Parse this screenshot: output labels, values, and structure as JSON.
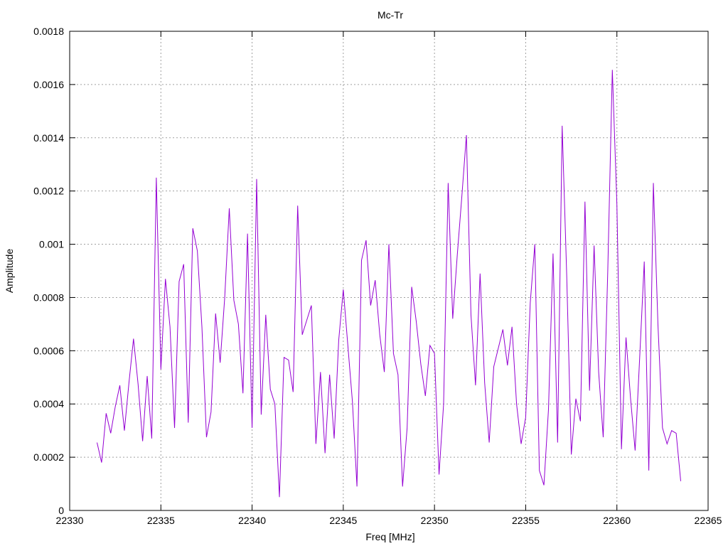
{
  "chart_data": {
    "type": "line",
    "title": "Mc-Tr",
    "xlabel": "Freq [MHz]",
    "ylabel": "Amplitude",
    "xlim": [
      22330,
      22365
    ],
    "ylim": [
      0,
      0.0018
    ],
    "xticks": [
      22330,
      22335,
      22340,
      22345,
      22350,
      22355,
      22360,
      22365
    ],
    "xtick_labels": [
      "22330",
      "22335",
      "22340",
      "22345",
      "22350",
      "22355",
      "22360",
      "22365"
    ],
    "yticks": [
      0,
      0.0002,
      0.0004,
      0.0006,
      0.0008,
      0.001,
      0.0012,
      0.0014,
      0.0016,
      0.0018
    ],
    "ytick_labels": [
      "0",
      "0.0002",
      "0.0004",
      "0.0006",
      "0.0008",
      "0.001",
      "0.0012",
      "0.0014",
      "0.0016",
      "0.0018"
    ],
    "grid": true,
    "legend": "none",
    "colors": {
      "line": "#9400d3",
      "grid": "#a0a0a0",
      "axis": "#000000"
    },
    "series": [
      {
        "x": [
          22331.5,
          22331.75,
          22332.0,
          22332.25,
          22332.5,
          22332.75,
          22333.0,
          22333.25,
          22333.5,
          22333.75,
          22334.0,
          22334.25,
          22334.5,
          22334.75,
          22335.0,
          22335.25,
          22335.5,
          22335.75,
          22336.0,
          22336.25,
          22336.5,
          22336.75,
          22337.0,
          22337.25,
          22337.5,
          22337.75,
          22338.0,
          22338.25,
          22338.5,
          22338.75,
          22339.0,
          22339.25,
          22339.5,
          22339.75,
          22340.0,
          22340.25,
          22340.5,
          22340.75,
          22341.0,
          22341.25,
          22341.5,
          22341.75,
          22342.0,
          22342.25,
          22342.5,
          22342.75,
          22343.0,
          22343.25,
          22343.5,
          22343.75,
          22344.0,
          22344.25,
          22344.5,
          22344.75,
          22345.0,
          22345.25,
          22345.5,
          22345.75,
          22346.0,
          22346.25,
          22346.5,
          22346.75,
          22347.0,
          22347.25,
          22347.5,
          22347.75,
          22348.0,
          22348.25,
          22348.5,
          22348.75,
          22349.0,
          22349.25,
          22349.5,
          22349.75,
          22350.0,
          22350.25,
          22350.5,
          22350.75,
          22351.0,
          22351.25,
          22351.5,
          22351.75,
          22352.0,
          22352.25,
          22352.5,
          22352.75,
          22353.0,
          22353.25,
          22353.5,
          22353.75,
          22354.0,
          22354.25,
          22354.5,
          22354.75,
          22355.0,
          22355.25,
          22355.5,
          22355.75,
          22356.0,
          22356.25,
          22356.5,
          22356.75,
          22357.0,
          22357.25,
          22357.5,
          22357.75,
          22358.0,
          22358.25,
          22358.5,
          22358.75,
          22359.0,
          22359.25,
          22359.5,
          22359.75,
          22360.0,
          22360.25,
          22360.5,
          22360.75,
          22361.0,
          22361.25,
          22361.5,
          22361.75,
          22362.0,
          22362.25,
          22362.5,
          22362.75,
          22363.0,
          22363.25,
          22363.5
        ],
        "y": [
          0.000255,
          0.00018,
          0.000365,
          0.00029,
          0.00039,
          0.00047,
          0.0003,
          0.00048,
          0.000645,
          0.000475,
          0.00026,
          0.000505,
          0.00027,
          0.00125,
          0.00053,
          0.00087,
          0.00069,
          0.00031,
          0.00086,
          0.000925,
          0.00033,
          0.00106,
          0.000975,
          0.00069,
          0.000275,
          0.00037,
          0.00074,
          0.000555,
          0.0008,
          0.001135,
          0.00079,
          0.0007,
          0.00044,
          0.00104,
          0.00031,
          0.001245,
          0.00036,
          0.000735,
          0.000455,
          0.0004,
          5e-05,
          0.000575,
          0.000565,
          0.000445,
          0.001145,
          0.00066,
          0.000715,
          0.00077,
          0.00025,
          0.00052,
          0.000215,
          0.00051,
          0.00027,
          0.00064,
          0.00083,
          0.00062,
          0.00041,
          9e-05,
          0.00094,
          0.001015,
          0.00077,
          0.000865,
          0.00066,
          0.00052,
          0.001,
          0.00059,
          0.00051,
          9e-05,
          0.00031,
          0.00084,
          0.00071,
          0.00055,
          0.00043,
          0.00062,
          0.00059,
          0.000135,
          0.0004,
          0.00123,
          0.00072,
          0.00096,
          0.00118,
          0.00141,
          0.000735,
          0.00047,
          0.00089,
          0.00048,
          0.000255,
          0.00054,
          0.00061,
          0.00068,
          0.000545,
          0.00069,
          0.0004,
          0.00025,
          0.00035,
          0.00078,
          0.001,
          0.00015,
          9.5e-05,
          0.00038,
          0.000965,
          0.000255,
          0.001445,
          0.00088,
          0.00021,
          0.00042,
          0.000335,
          0.00116,
          0.00045,
          0.000995,
          0.00052,
          0.000275,
          0.0009,
          0.001655,
          0.00115,
          0.00023,
          0.00065,
          0.00042,
          0.000225,
          0.000575,
          0.000935,
          0.00015,
          0.00123,
          0.0007,
          0.00031,
          0.00025,
          0.0003,
          0.00029,
          0.00011
        ]
      }
    ]
  }
}
